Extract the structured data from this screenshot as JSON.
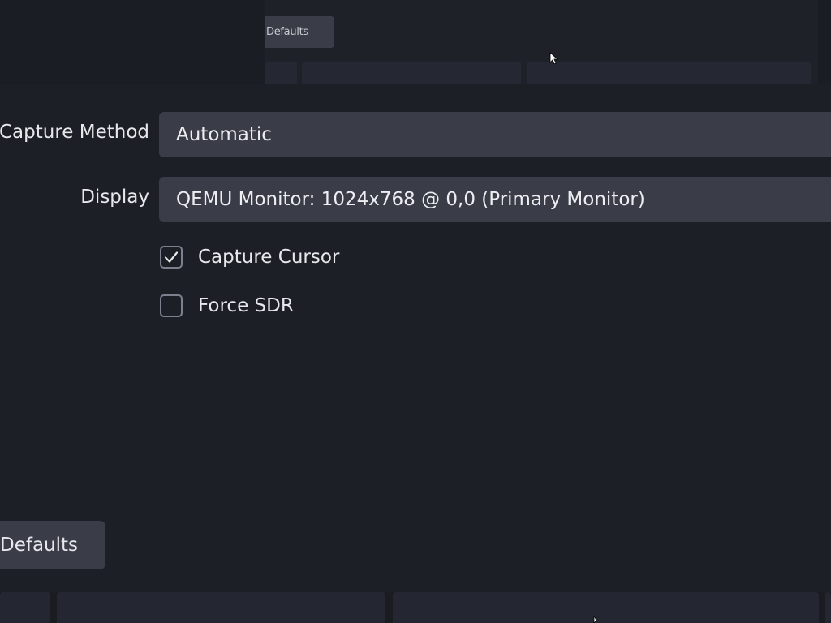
{
  "background_window": {
    "defaults_button_label": "Defaults"
  },
  "properties": {
    "capture_method": {
      "label": "Capture Method",
      "value": "Automatic"
    },
    "display": {
      "label": "Display",
      "value": "QEMU Monitor: 1024x768 @ 0,0 (Primary Monitor)"
    },
    "capture_cursor": {
      "label": "Capture Cursor",
      "checked": true
    },
    "force_sdr": {
      "label": "Force SDR",
      "checked": false
    }
  },
  "footer": {
    "defaults_button_label": "Defaults"
  },
  "colors": {
    "background": "#1d1f26",
    "control": "#3a3d48",
    "checkbox_border": "#7d818d",
    "text": "#e6e8ec"
  }
}
